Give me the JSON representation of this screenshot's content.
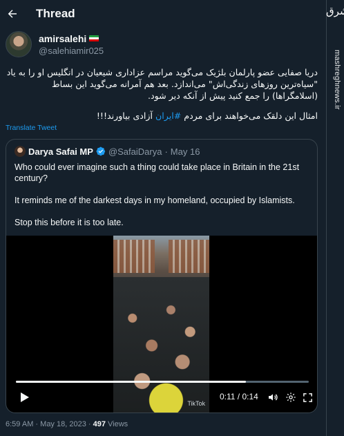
{
  "header": {
    "title": "Thread"
  },
  "watermark": {
    "logo": "مشرق",
    "site": "mashreghnews.ir"
  },
  "author": {
    "name": "amirsalehi",
    "handle": "@salehiamir025"
  },
  "tweet": {
    "paragraph1": "دریا صفایی عضو پارلمان بلژیک می‌گوید مراسم عزاداری شیعیان در انگلیس او را به یاد \"سیاه‌ترین روزهای زندگی‌اش\" می‌اندازد. بعد هم آمرانه می‌گوید این بساط (اسلامگراها) را جمع کنید پیش از آنکه دیر شود.",
    "paragraph2_before": "امثال این دلقک می‌خواهند برای مردم ",
    "hashtag": "#ایران",
    "paragraph2_after": " آزادی بیاورند!!!"
  },
  "translate_label": "Translate Tweet",
  "quote": {
    "name": "Darya Safai MP",
    "handle": "@SafaiDarya",
    "date": "May 16",
    "line1": "Who could ever imagine such a thing could take place in Britain in the 21st century?",
    "line2": "It reminds me of the darkest days in my homeland, occupied by Islamists.",
    "line3": "Stop this before it is too late."
  },
  "video": {
    "time": "0:11 / 0:14",
    "progress": 0.786,
    "watermark": "TikTok"
  },
  "footer": {
    "time": "6:59 AM",
    "date": "May 18, 2023",
    "views_count": "497",
    "views_label": "Views"
  },
  "colors": {
    "background": "#15202b",
    "accent": "#1d9bf0",
    "text": "#f7f9f9",
    "muted": "#8b98a5",
    "border": "#38444d"
  }
}
